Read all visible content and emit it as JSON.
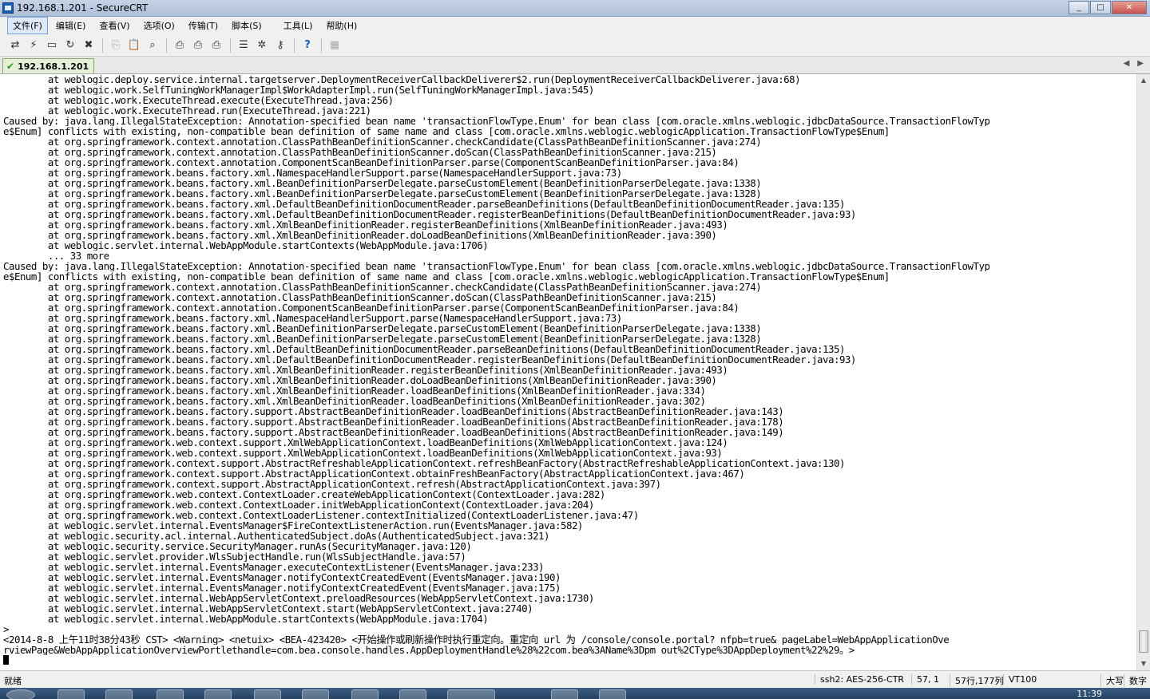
{
  "window": {
    "title": "192.168.1.201 - SecureCRT"
  },
  "menu": [
    {
      "label": "文件(F)",
      "active": true
    },
    {
      "label": "编辑(E)"
    },
    {
      "label": "查看(V)"
    },
    {
      "label": "选项(O)"
    },
    {
      "label": "传输(T)"
    },
    {
      "label": "脚本(S)"
    },
    {
      "label": "工具(L)",
      "gap": true
    },
    {
      "label": "帮助(H)"
    }
  ],
  "toolbar": {
    "groups": [
      [
        "connect-icon",
        "quick-connect-icon",
        "connect-tab-icon",
        "reconnect-icon",
        "disconnect-icon"
      ],
      [
        "copy-icon",
        "paste-icon",
        "find-icon"
      ],
      [
        "print-icon",
        "print-selection-icon",
        "print-setup-icon"
      ],
      [
        "session-options-icon",
        "global-options-icon",
        "keymap-icon"
      ],
      [
        "help-icon"
      ],
      [
        "sftp-icon"
      ]
    ]
  },
  "tab": {
    "label": "192.168.1.201"
  },
  "terminal": {
    "lines": [
      "        at weblogic.deploy.service.internal.targetserver.DeploymentReceiverCallbackDeliverer$2.run(DeploymentReceiverCallbackDeliverer.java:68)",
      "        at weblogic.work.SelfTuningWorkManagerImpl$WorkAdapterImpl.run(SelfTuningWorkManagerImpl.java:545)",
      "        at weblogic.work.ExecuteThread.execute(ExecuteThread.java:256)",
      "        at weblogic.work.ExecuteThread.run(ExecuteThread.java:221)",
      "Caused by: java.lang.IllegalStateException: Annotation-specified bean name 'transactionFlowType.Enum' for bean class [com.oracle.xmlns.weblogic.jdbcDataSource.TransactionFlowTyp",
      "e$Enum] conflicts with existing, non-compatible bean definition of same name and class [com.oracle.xmlns.weblogic.weblogicApplication.TransactionFlowType$Enum]",
      "        at org.springframework.context.annotation.ClassPathBeanDefinitionScanner.checkCandidate(ClassPathBeanDefinitionScanner.java:274)",
      "        at org.springframework.context.annotation.ClassPathBeanDefinitionScanner.doScan(ClassPathBeanDefinitionScanner.java:215)",
      "        at org.springframework.context.annotation.ComponentScanBeanDefinitionParser.parse(ComponentScanBeanDefinitionParser.java:84)",
      "        at org.springframework.beans.factory.xml.NamespaceHandlerSupport.parse(NamespaceHandlerSupport.java:73)",
      "        at org.springframework.beans.factory.xml.BeanDefinitionParserDelegate.parseCustomElement(BeanDefinitionParserDelegate.java:1338)",
      "        at org.springframework.beans.factory.xml.BeanDefinitionParserDelegate.parseCustomElement(BeanDefinitionParserDelegate.java:1328)",
      "        at org.springframework.beans.factory.xml.DefaultBeanDefinitionDocumentReader.parseBeanDefinitions(DefaultBeanDefinitionDocumentReader.java:135)",
      "        at org.springframework.beans.factory.xml.DefaultBeanDefinitionDocumentReader.registerBeanDefinitions(DefaultBeanDefinitionDocumentReader.java:93)",
      "        at org.springframework.beans.factory.xml.XmlBeanDefinitionReader.registerBeanDefinitions(XmlBeanDefinitionReader.java:493)",
      "        at org.springframework.beans.factory.xml.XmlBeanDefinitionReader.doLoadBeanDefinitions(XmlBeanDefinitionReader.java:390)",
      "        at weblogic.servlet.internal.WebAppModule.startContexts(WebAppModule.java:1706)",
      "        ... 33 more",
      "Caused by: java.lang.IllegalStateException: Annotation-specified bean name 'transactionFlowType.Enum' for bean class [com.oracle.xmlns.weblogic.jdbcDataSource.TransactionFlowTyp",
      "e$Enum] conflicts with existing, non-compatible bean definition of same name and class [com.oracle.xmlns.weblogic.weblogicApplication.TransactionFlowType$Enum]",
      "        at org.springframework.context.annotation.ClassPathBeanDefinitionScanner.checkCandidate(ClassPathBeanDefinitionScanner.java:274)",
      "        at org.springframework.context.annotation.ClassPathBeanDefinitionScanner.doScan(ClassPathBeanDefinitionScanner.java:215)",
      "        at org.springframework.context.annotation.ComponentScanBeanDefinitionParser.parse(ComponentScanBeanDefinitionParser.java:84)",
      "        at org.springframework.beans.factory.xml.NamespaceHandlerSupport.parse(NamespaceHandlerSupport.java:73)",
      "        at org.springframework.beans.factory.xml.BeanDefinitionParserDelegate.parseCustomElement(BeanDefinitionParserDelegate.java:1338)",
      "        at org.springframework.beans.factory.xml.BeanDefinitionParserDelegate.parseCustomElement(BeanDefinitionParserDelegate.java:1328)",
      "        at org.springframework.beans.factory.xml.DefaultBeanDefinitionDocumentReader.parseBeanDefinitions(DefaultBeanDefinitionDocumentReader.java:135)",
      "        at org.springframework.beans.factory.xml.DefaultBeanDefinitionDocumentReader.registerBeanDefinitions(DefaultBeanDefinitionDocumentReader.java:93)",
      "        at org.springframework.beans.factory.xml.XmlBeanDefinitionReader.registerBeanDefinitions(XmlBeanDefinitionReader.java:493)",
      "        at org.springframework.beans.factory.xml.XmlBeanDefinitionReader.doLoadBeanDefinitions(XmlBeanDefinitionReader.java:390)",
      "        at org.springframework.beans.factory.xml.XmlBeanDefinitionReader.loadBeanDefinitions(XmlBeanDefinitionReader.java:334)",
      "        at org.springframework.beans.factory.xml.XmlBeanDefinitionReader.loadBeanDefinitions(XmlBeanDefinitionReader.java:302)",
      "        at org.springframework.beans.factory.support.AbstractBeanDefinitionReader.loadBeanDefinitions(AbstractBeanDefinitionReader.java:143)",
      "        at org.springframework.beans.factory.support.AbstractBeanDefinitionReader.loadBeanDefinitions(AbstractBeanDefinitionReader.java:178)",
      "        at org.springframework.beans.factory.support.AbstractBeanDefinitionReader.loadBeanDefinitions(AbstractBeanDefinitionReader.java:149)",
      "        at org.springframework.web.context.support.XmlWebApplicationContext.loadBeanDefinitions(XmlWebApplicationContext.java:124)",
      "        at org.springframework.web.context.support.XmlWebApplicationContext.loadBeanDefinitions(XmlWebApplicationContext.java:93)",
      "        at org.springframework.context.support.AbstractRefreshableApplicationContext.refreshBeanFactory(AbstractRefreshableApplicationContext.java:130)",
      "        at org.springframework.context.support.AbstractApplicationContext.obtainFreshBeanFactory(AbstractApplicationContext.java:467)",
      "        at org.springframework.context.support.AbstractApplicationContext.refresh(AbstractApplicationContext.java:397)",
      "        at org.springframework.web.context.ContextLoader.createWebApplicationContext(ContextLoader.java:282)",
      "        at org.springframework.web.context.ContextLoader.initWebApplicationContext(ContextLoader.java:204)",
      "        at org.springframework.web.context.ContextLoaderListener.contextInitialized(ContextLoaderListener.java:47)",
      "        at weblogic.servlet.internal.EventsManager$FireContextListenerAction.run(EventsManager.java:582)",
      "        at weblogic.security.acl.internal.AuthenticatedSubject.doAs(AuthenticatedSubject.java:321)",
      "        at weblogic.security.service.SecurityManager.runAs(SecurityManager.java:120)",
      "        at weblogic.servlet.provider.WlsSubjectHandle.run(WlsSubjectHandle.java:57)",
      "        at weblogic.servlet.internal.EventsManager.executeContextListener(EventsManager.java:233)",
      "        at weblogic.servlet.internal.EventsManager.notifyContextCreatedEvent(EventsManager.java:190)",
      "        at weblogic.servlet.internal.EventsManager.notifyContextCreatedEvent(EventsManager.java:175)",
      "        at weblogic.servlet.internal.WebAppServletContext.preloadResources(WebAppServletContext.java:1730)",
      "        at weblogic.servlet.internal.WebAppServletContext.start(WebAppServletContext.java:2740)",
      "        at weblogic.servlet.internal.WebAppModule.startContexts(WebAppModule.java:1704)",
      ">",
      "<2014-8-8 上午11时38分43秒 CST> <Warning> <netuix> <BEA-423420> <开始操作或刷新操作时执行重定向。重定向 url 为 /console/console.portal?_nfpb=true&_pageLabel=WebAppApplicationOve",
      "rviewPage&WebAppApplicationOverviewPortlethandle=com.bea.console.handles.AppDeploymentHandle%28%22com.bea%3AName%3Dpm_out%2CType%3DAppDeployment%22%29。>"
    ]
  },
  "status": {
    "ready": "就绪",
    "ssh": "ssh2: AES-256-CTR",
    "pos": "57,  1",
    "size": "57行,177列",
    "term": "VT100",
    "caps": "大写",
    "num": "数字"
  },
  "taskbar": {
    "clock": "11:39"
  }
}
